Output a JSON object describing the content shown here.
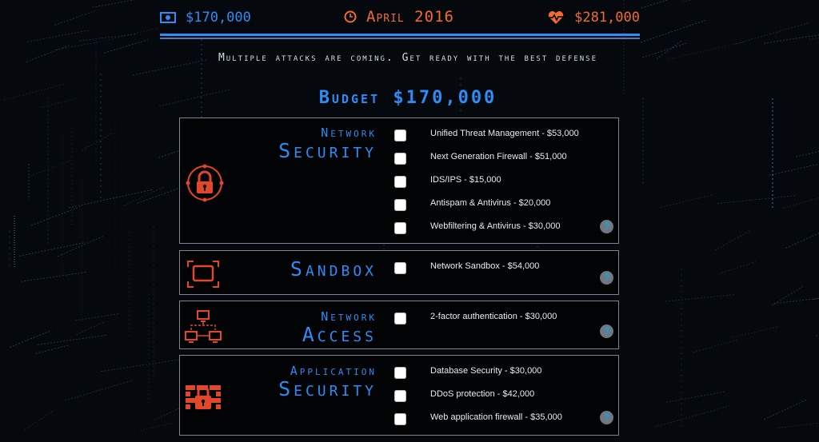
{
  "header": {
    "money": "$170,000",
    "date": "April 2016",
    "health": "$281,000",
    "icons": {
      "money": "banknote-icon",
      "date": "clock-icon",
      "health": "heartbeat-icon"
    },
    "colors": {
      "blue": "#2d8cf5",
      "orange": "#f26b30"
    }
  },
  "intro": "Multiple attacks are coming. Get ready with the best defense",
  "budget": {
    "label": "Budget",
    "amount": "$170,000"
  },
  "categories": [
    {
      "title_line1": "Network",
      "title_line2": "Security",
      "icon": "padlock-icon",
      "options": [
        {
          "label": "Unified Threat Management - $53,000",
          "checked": false
        },
        {
          "label": "Next Generation Firewall - $51,000",
          "checked": false
        },
        {
          "label": "IDS/IPS - $15,000",
          "checked": false
        },
        {
          "label": "Antispam & Antivirus - $20,000",
          "checked": false
        },
        {
          "label": "Webfiltering & Antivirus - $30,000",
          "checked": false
        }
      ],
      "help": "?"
    },
    {
      "title_line1": "",
      "title_line2": "Sandbox",
      "icon": "sandbox-screen-icon",
      "options": [
        {
          "label": "Network Sandbox - $54,000",
          "checked": false
        }
      ],
      "help": "?"
    },
    {
      "title_line1": "Network",
      "title_line2": "Access",
      "icon": "network-computers-icon",
      "options": [
        {
          "label": "2-factor authentication - $30,000",
          "checked": false
        }
      ],
      "help": "?"
    },
    {
      "title_line1": "Application",
      "title_line2": "Security",
      "icon": "firewall-lock-icon",
      "options": [
        {
          "label": "Database Security - $30,000",
          "checked": false
        },
        {
          "label": "DDoS protection - $42,000",
          "checked": false
        },
        {
          "label": "Web application firewall - $35,000",
          "checked": false
        }
      ],
      "help": "?"
    }
  ]
}
